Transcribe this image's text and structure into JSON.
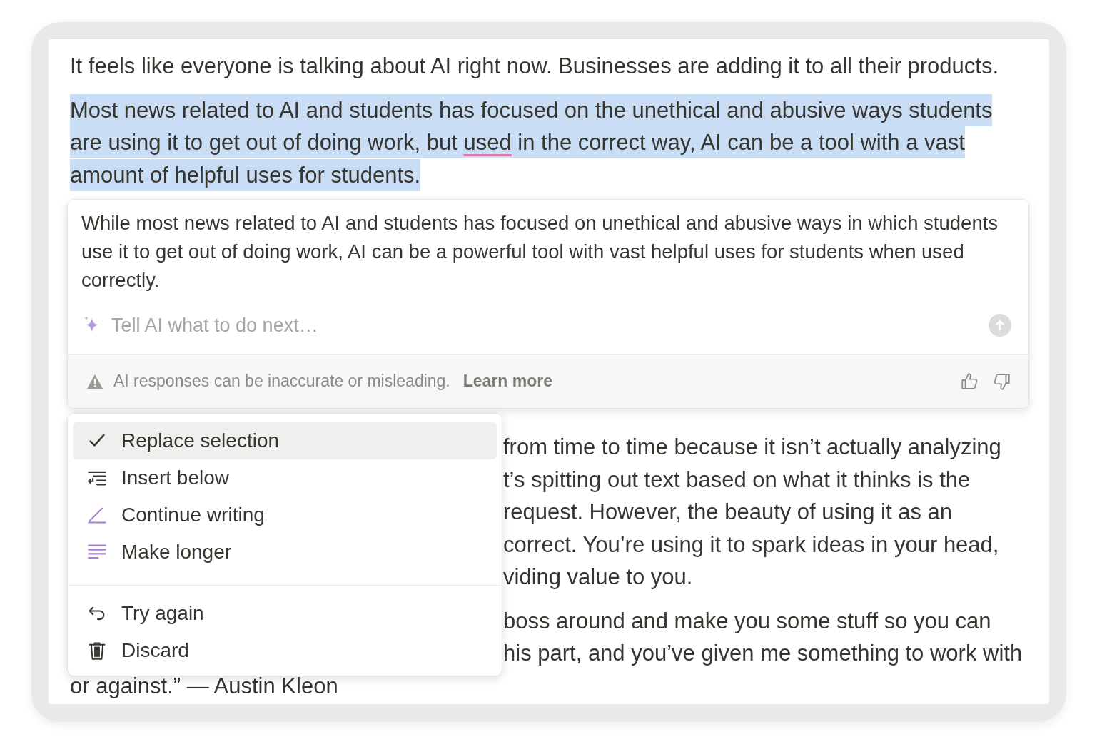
{
  "document": {
    "paragraphs": [
      {
        "kind": "full",
        "selected": false,
        "segments": [
          {
            "text": "It feels like everyone is talking about AI right now. Businesses are adding it to all their products.",
            "misspelled": false
          }
        ]
      },
      {
        "kind": "full",
        "selected": true,
        "segments": [
          {
            "text": "Most news related to AI and students has focused on the unethical and abusive ways students are using it to get out of doing work, but ",
            "misspelled": false
          },
          {
            "text": "used",
            "misspelled": true
          },
          {
            "text": " in the correct way, AI can be a tool with a vast amount of helpful uses for students.",
            "misspelled": false
          }
        ]
      },
      {
        "kind": "hidden"
      },
      {
        "kind": "fragments",
        "lines": [
          "from time to time because it isn’t actually analyzing",
          "t’s spitting out text based on what it thinks is the",
          "request. However, the beauty of using it as an",
          "correct. You’re using it to spark ideas in your head,",
          "viding value to you."
        ]
      },
      {
        "kind": "fragments",
        "lines": [
          "boss around and make you some stuff so you can",
          "his part, and you’ve given me something to work with"
        ],
        "tail": "or against.” — Austin Kleon"
      }
    ]
  },
  "ai_panel": {
    "response": "While most news related to AI and students has focused on unethical and abusive ways in which students use it to get out of doing work, AI can be a powerful tool with vast helpful uses for students when used correctly.",
    "prompt": {
      "placeholder": "Tell AI what to do next…"
    },
    "footer": {
      "warning": "AI responses can be inaccurate or misleading.",
      "link": "Learn more"
    }
  },
  "menu": {
    "groups": [
      [
        {
          "label": "Replace selection",
          "selected": true
        },
        {
          "label": "Insert below",
          "selected": false
        },
        {
          "label": "Continue writing",
          "selected": false
        },
        {
          "label": "Make longer",
          "selected": false
        }
      ],
      [
        {
          "label": "Try again",
          "selected": false
        },
        {
          "label": "Discard",
          "selected": false
        }
      ]
    ]
  }
}
